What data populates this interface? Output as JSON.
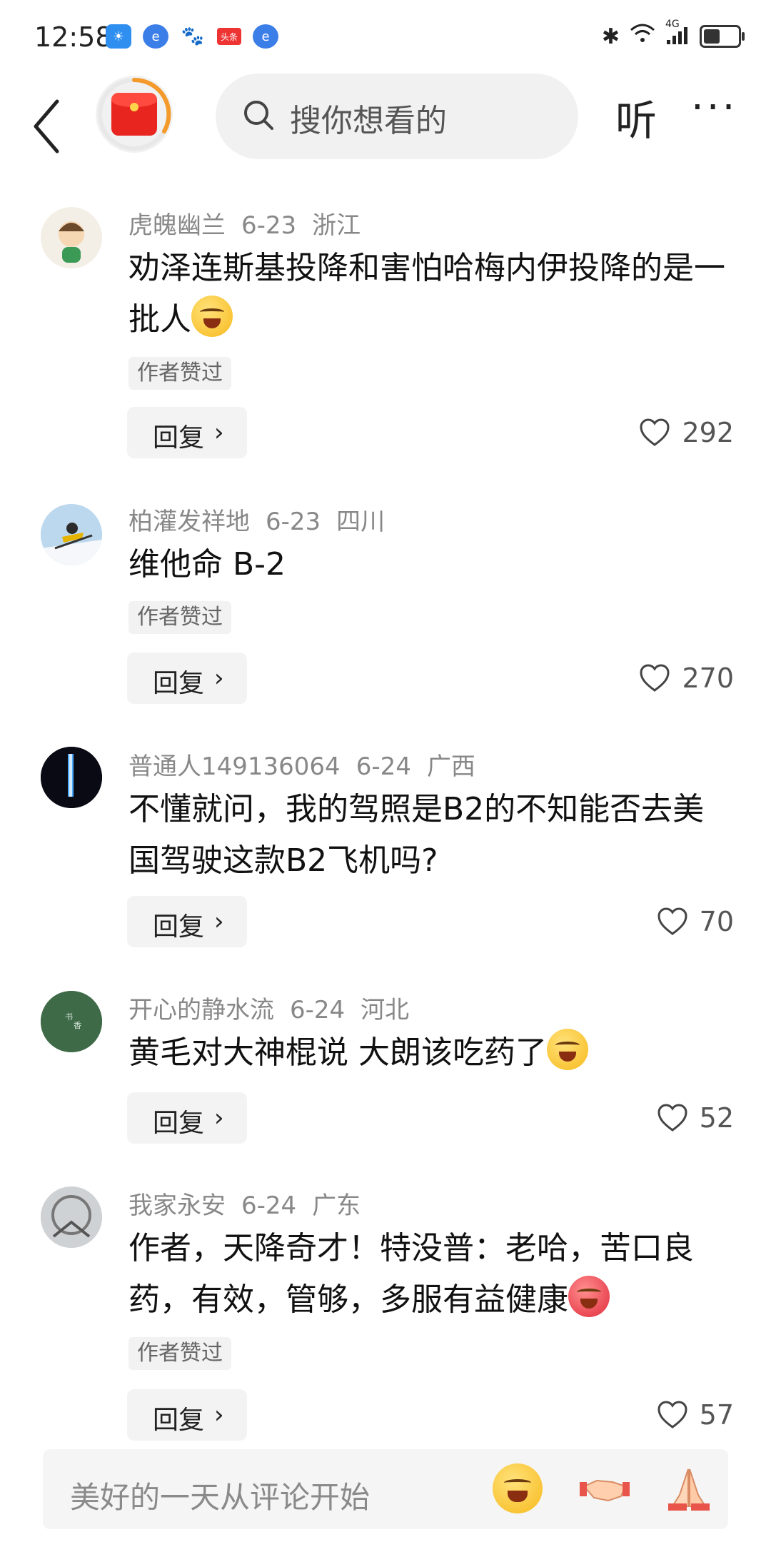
{
  "status_bar": {
    "time": "12:58",
    "icons": [
      "weather-icon",
      "browser-icon",
      "baidu-icon",
      "toutiao-icon",
      "browser-icon"
    ],
    "toutiao_text": "头条",
    "network": "4G"
  },
  "header": {
    "search_placeholder": "搜你想看的",
    "listen_label": "听",
    "more_label": "···"
  },
  "comments": [
    {
      "user": "虎魄幽兰",
      "date": "6-23",
      "location": "浙江",
      "text": "劝泽连斯基投降和害怕哈梅内伊投降的是一批人",
      "tag": "作者赞过",
      "reply": "回复",
      "likes": "292"
    },
    {
      "user": "柏灌发祥地",
      "date": "6-23",
      "location": "四川",
      "text": "维他命 B-2",
      "tag": "作者赞过",
      "reply": "回复",
      "likes": "270"
    },
    {
      "user": "普通人149136064",
      "date": "6-24",
      "location": "广西",
      "text": "不懂就问，我的驾照是B2的不知能否去美国驾驶这款B2飞机吗?",
      "tag": "",
      "reply": "回复",
      "likes": "70"
    },
    {
      "user": "开心的静水流",
      "date": "6-24",
      "location": "河北",
      "text": "黄毛对大神棍说 大朗该吃药了",
      "tag": "",
      "reply": "回复",
      "likes": "52"
    },
    {
      "user": "我家永安",
      "date": "6-24",
      "location": "广东",
      "text": "作者，天降奇才！特没普：老哈，苦口良药，有效，管够，多服有益健康",
      "tag": "作者赞过",
      "reply": "回复",
      "likes": "57"
    }
  ],
  "bottom": {
    "input_placeholder": "美好的一天从评论开始"
  }
}
